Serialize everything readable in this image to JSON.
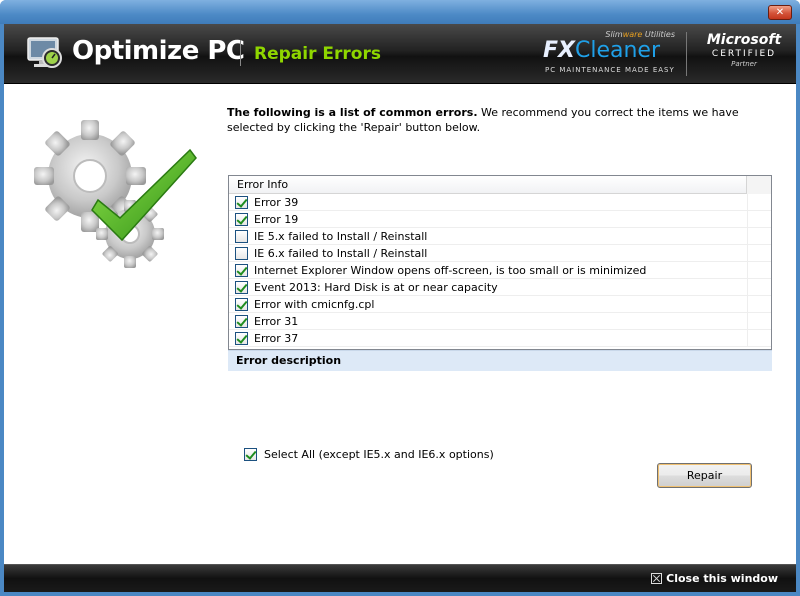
{
  "window": {
    "close_glyph": "✕"
  },
  "header": {
    "app_title": "Optimize PC",
    "section_title": "Repair Errors",
    "app_icon": "monitor-gauge-icon",
    "brand": {
      "top_line_a": "Slim",
      "top_line_b": "ware",
      "top_line_c": " Utilities",
      "name_fx": "FX",
      "name_cleaner": "Cleaner",
      "tagline": "PC MAINTENANCE MADE EASY"
    },
    "partner": {
      "name": "Microsoft",
      "certified": "CERTIFIED",
      "partner": "Partner"
    }
  },
  "intro": {
    "bold": "The following is a list of common errors.",
    "text": "  We recommend you correct the items we have selected by clicking the 'Repair' button below."
  },
  "error_list": {
    "column_header": "Error Info",
    "items": [
      {
        "label": "Error 39",
        "checked": true
      },
      {
        "label": "Error 19",
        "checked": true
      },
      {
        "label": "IE 5.x failed to Install / Reinstall",
        "checked": false
      },
      {
        "label": "IE 6.x failed to Install / Reinstall",
        "checked": false
      },
      {
        "label": "Internet Explorer Window opens off-screen, is too small or is minimized",
        "checked": true
      },
      {
        "label": "Event 2013:  Hard Disk is at or near capacity",
        "checked": true
      },
      {
        "label": "Error with cmicnfg.cpl",
        "checked": true
      },
      {
        "label": "Error 31",
        "checked": true
      },
      {
        "label": "Error 37",
        "checked": true
      }
    ]
  },
  "description": {
    "label": "Error description"
  },
  "select_all": {
    "label": "Select All (except IE5.x and IE6.x options)",
    "checked": true
  },
  "repair_button": {
    "label": "Repair"
  },
  "footer": {
    "close_label": "Close this window"
  },
  "colors": {
    "accent_green": "#8fd600",
    "brand_blue": "#1fa0e8",
    "title_bar": "#4d8ac6",
    "header_bg": "#222222",
    "description_bg": "#dde9f7"
  }
}
